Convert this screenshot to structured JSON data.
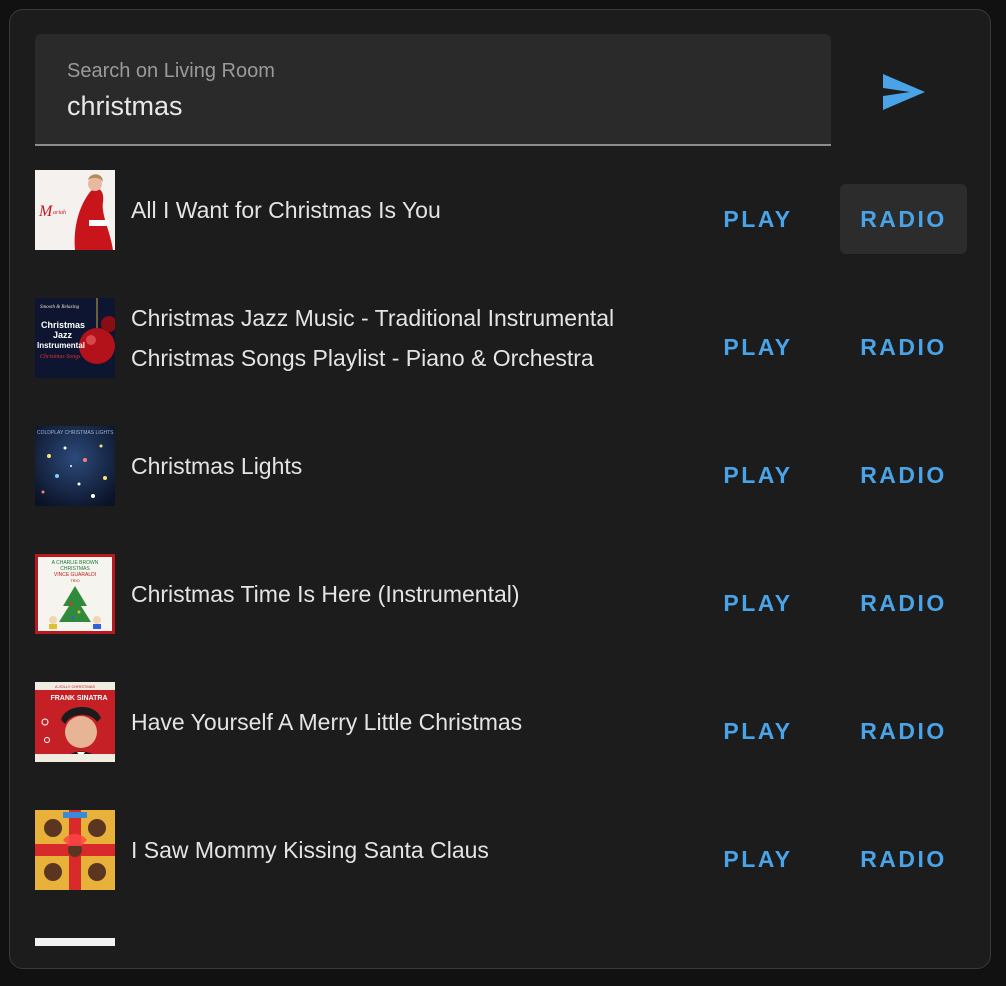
{
  "search": {
    "label": "Search on Living Room",
    "value": "christmas"
  },
  "send_icon": "send-icon",
  "results": [
    {
      "title": "All I Want for Christmas Is You",
      "play_label": "PLAY",
      "radio_label": "RADIO"
    },
    {
      "title": "Christmas Jazz Music - Traditional Instrumental Christmas Songs Playlist - Piano & Orchestra",
      "play_label": "PLAY",
      "radio_label": "RADIO"
    },
    {
      "title": "Christmas Lights",
      "play_label": "PLAY",
      "radio_label": "RADIO"
    },
    {
      "title": "Christmas Time Is Here (Instrumental)",
      "play_label": "PLAY",
      "radio_label": "RADIO"
    },
    {
      "title": "Have Yourself A Merry Little Christmas",
      "play_label": "PLAY",
      "radio_label": "RADIO"
    },
    {
      "title": "I Saw Mommy Kissing Santa Claus",
      "play_label": "PLAY",
      "radio_label": "RADIO"
    }
  ],
  "album_art_text": {
    "jazz": [
      "Smooth & Relaxing",
      "Christmas",
      "Jazz",
      "Instrumental",
      "Christmas Songs"
    ],
    "lights": "COLDPLAY CHRISTMAS LIGHTS",
    "charlie_brown": [
      "A CHARLIE BROWN",
      "CHRISTMAS",
      "VINCE GUARALDI",
      "TRIO"
    ],
    "sinatra": [
      "A JOLLY CHRISTMAS",
      "FRANK SINATRA"
    ]
  },
  "colors": {
    "accent": "#4aa3e6",
    "background": "#1c1c1c",
    "field": "#2a2a2a"
  }
}
